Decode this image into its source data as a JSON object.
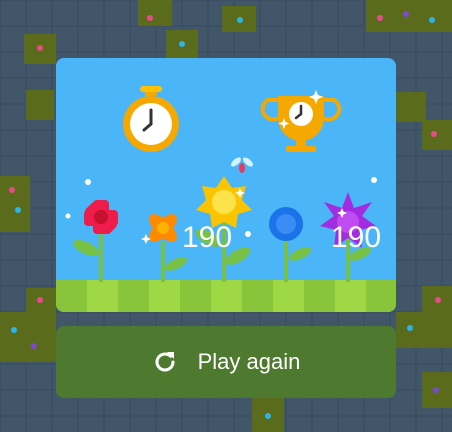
{
  "game": {
    "current_score": "190",
    "best_score": "190",
    "play_again_label": "Play again"
  },
  "icons": {
    "current": "stopwatch-icon",
    "best": "trophy-icon",
    "replay": "refresh-icon"
  },
  "colors": {
    "board_background": "#3d5063",
    "card_sky": "#4bb6f7",
    "grass_light": "#9ed844",
    "grass_dark": "#89c53b",
    "button": "#4e7a2f"
  }
}
